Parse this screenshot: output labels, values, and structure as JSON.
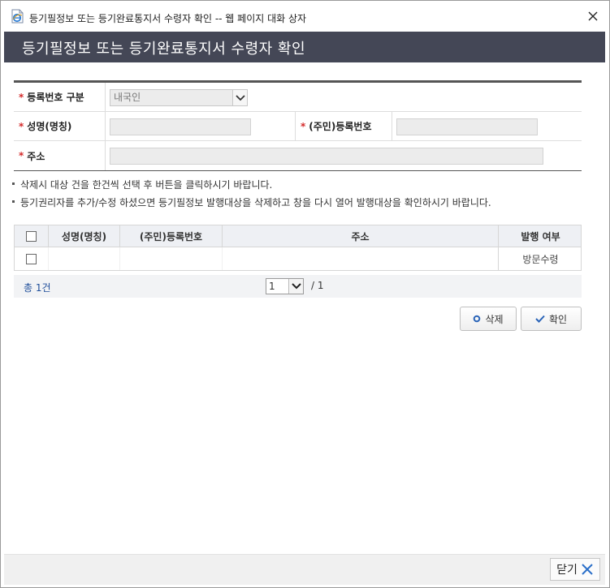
{
  "window": {
    "title": "등기필정보 또는 등기완료통지서 수령자 확인 -- 웹 페이지 대화 상자"
  },
  "header": {
    "title": "등기필정보 또는 등기완료통지서 수령자 확인"
  },
  "form": {
    "required_mark": "*",
    "reg_type_label": "등록번호 구분",
    "reg_type_value": "내국인",
    "name_label": "성명(명칭)",
    "name_value": "",
    "reg_no_label": "(주민)등록번호",
    "reg_no_value": "",
    "address_label": "주소",
    "address_value": ""
  },
  "notes": [
    "삭제시 대상 건을 한건씩 선택 후 버튼을 클릭하시기 바랍니다.",
    "등기권리자를 추가/수정 하셨으면 등기필정보 발행대상을 삭제하고 창을 다시 열어 발행대상을 확인하시기 바랍니다."
  ],
  "list": {
    "headers": [
      "성명(명칭)",
      "(주민)등록번호",
      "주소",
      "발행 여부"
    ],
    "rows": [
      {
        "name": "",
        "reg_no": "",
        "address": "",
        "issue": "방문수령"
      }
    ]
  },
  "paging": {
    "total": "총 1건",
    "current_page": "1",
    "total_pages": "/ 1"
  },
  "buttons": {
    "delete": "삭제",
    "confirm": "확인",
    "close": "닫기"
  },
  "colors": {
    "header_bg": "#444756",
    "required": "#d42a2a",
    "link_blue": "#1f4e9a",
    "close_x_blue": "#2a6fc9"
  }
}
